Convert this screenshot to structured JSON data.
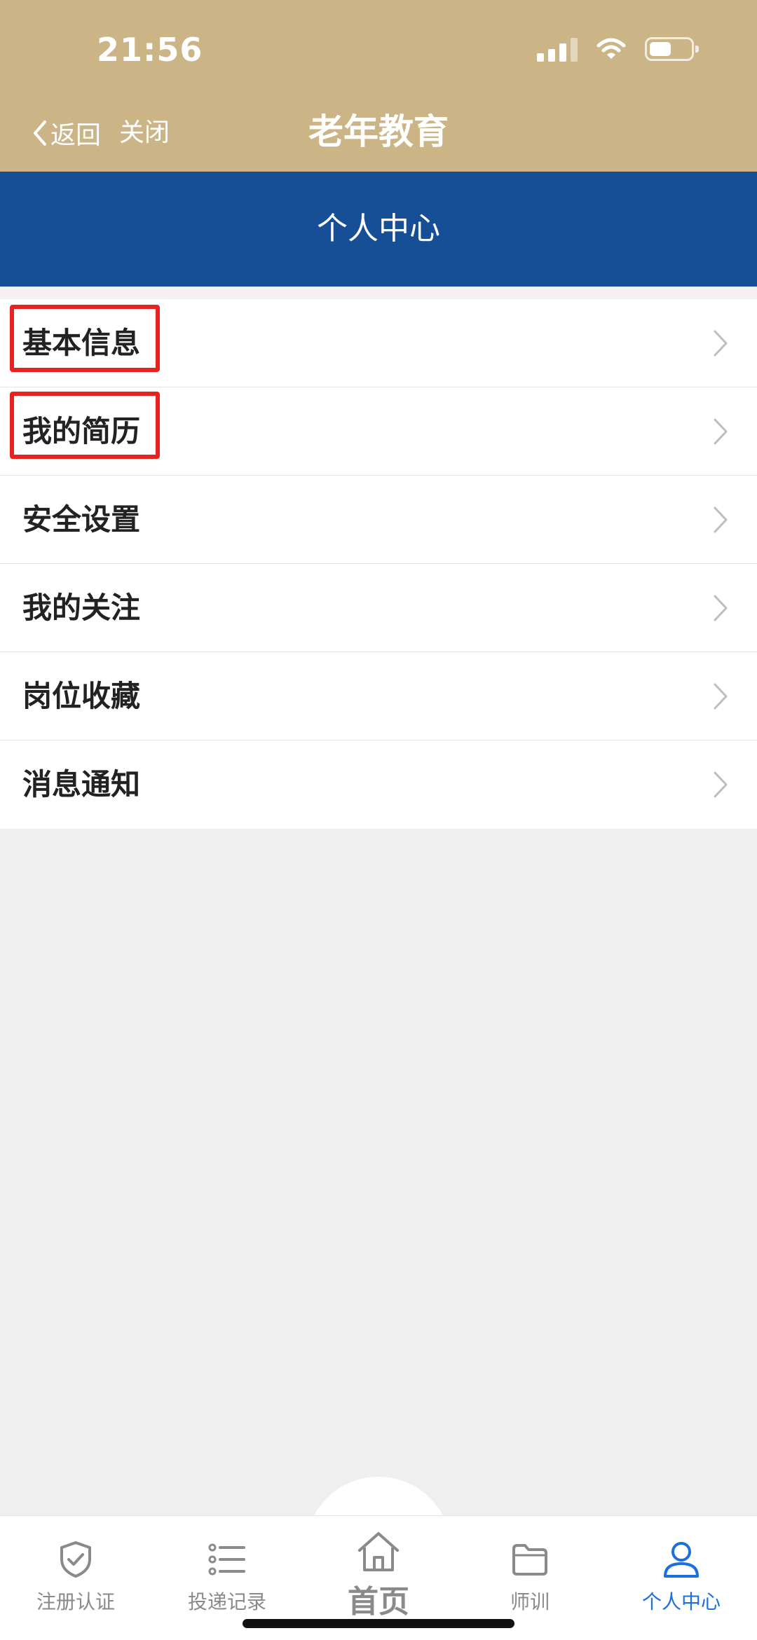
{
  "status_bar": {
    "time": "21:56",
    "icons": [
      "signal-icon",
      "wifi-icon",
      "battery-icon"
    ]
  },
  "nav": {
    "back_label": "返回",
    "close_label": "关闭",
    "title": "老年教育"
  },
  "page_header": {
    "title": "个人中心"
  },
  "menu": {
    "items": [
      {
        "label": "基本信息",
        "highlighted": true
      },
      {
        "label": "我的简历",
        "highlighted": true
      },
      {
        "label": "安全设置",
        "highlighted": false
      },
      {
        "label": "我的关注",
        "highlighted": false
      },
      {
        "label": "岗位收藏",
        "highlighted": false
      },
      {
        "label": "消息通知",
        "highlighted": false
      }
    ]
  },
  "tabbar": {
    "tabs": [
      {
        "label": "注册认证",
        "icon": "shield-check-icon",
        "active": false
      },
      {
        "label": "投递记录",
        "icon": "list-icon",
        "active": false
      },
      {
        "label": "首页",
        "icon": "home-icon",
        "active": false
      },
      {
        "label": "师训",
        "icon": "folder-icon",
        "active": false
      },
      {
        "label": "个人中心",
        "icon": "user-icon",
        "active": true
      }
    ]
  },
  "colors": {
    "nav_background": "#cbb486",
    "header_background": "#164f95",
    "highlight_border": "#e8231f",
    "active_tab": "#1b6fe0"
  }
}
